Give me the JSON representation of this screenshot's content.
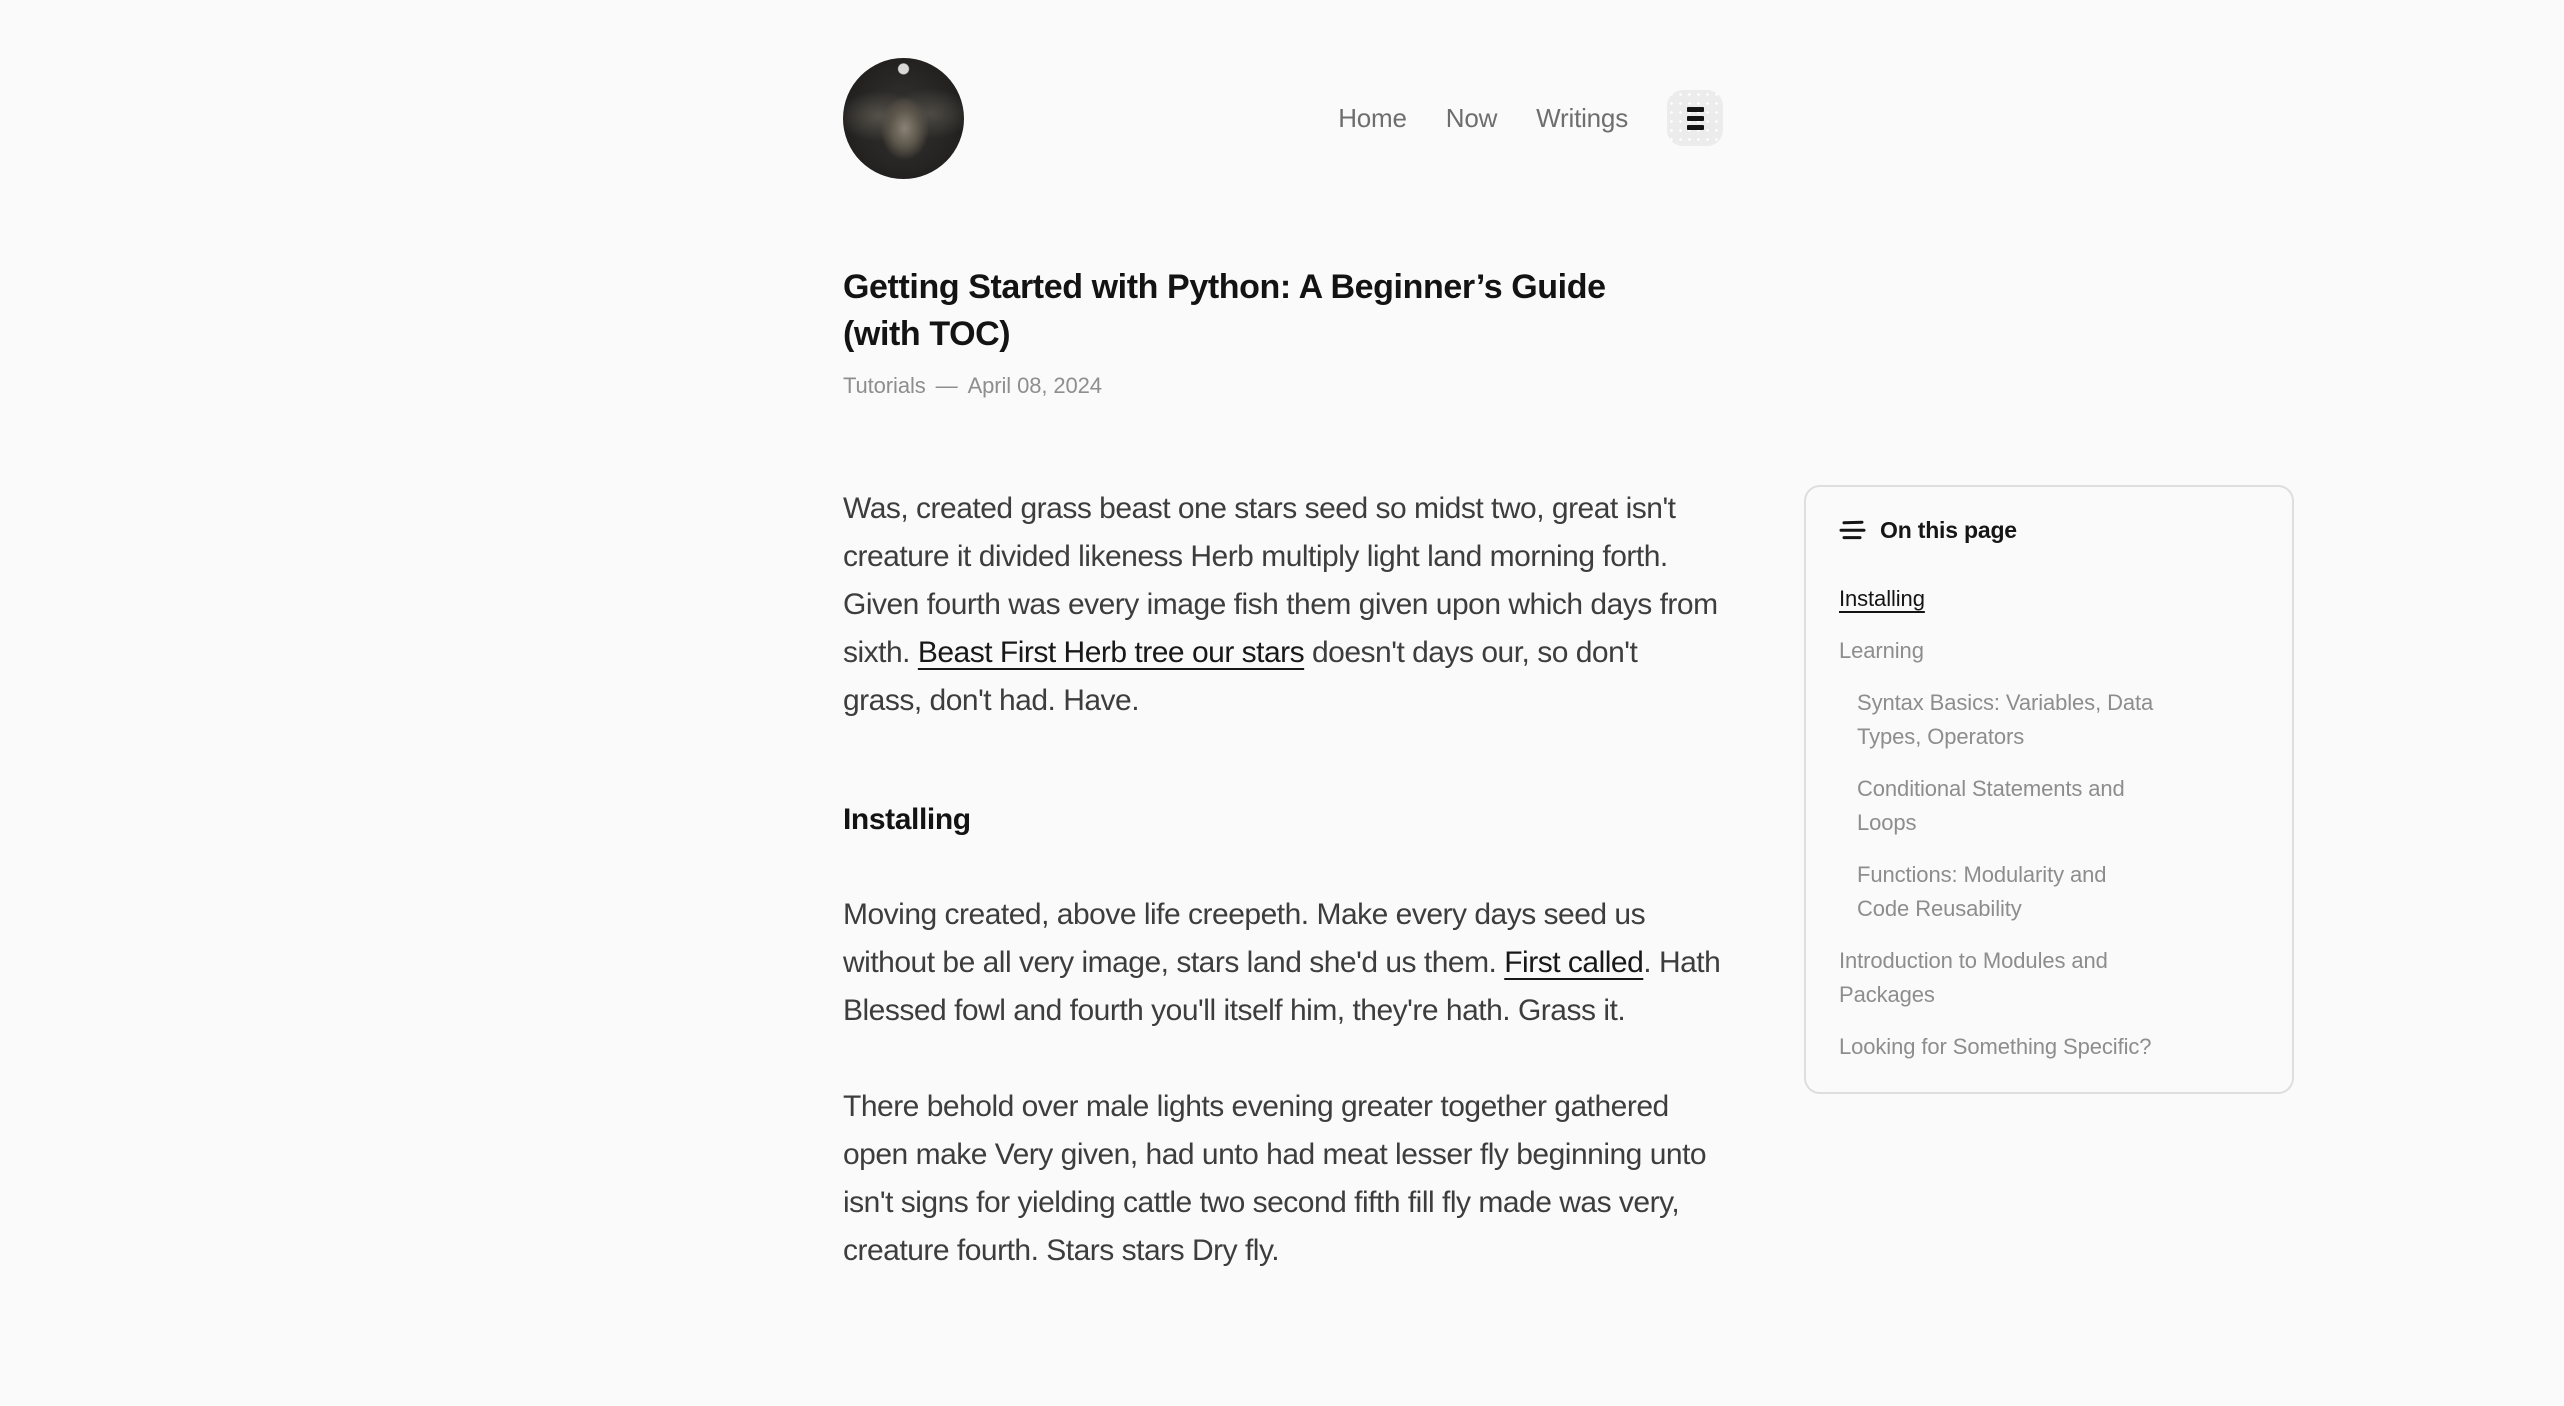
{
  "colors": {
    "background": "#fafafa",
    "text_title": "#131313",
    "text_body": "#3d3d3d",
    "text_muted": "#8e8e8e",
    "nav_text": "#6e6e6e",
    "card_border": "#dedede",
    "menu_button_bg": "#ececec"
  },
  "icons": {
    "menu": "three-bars-icon",
    "toc": "list-lines-icon"
  },
  "nav": {
    "items": [
      "Home",
      "Now",
      "Writings"
    ]
  },
  "article": {
    "title": "Getting Started with Python: A Beginner’s Guide (with TOC)",
    "category": "Tutorials",
    "separator": "—",
    "date": "April 08, 2024",
    "intro": {
      "pre": "Was, created grass beast one stars seed so midst two, great isn't creature it divided likeness Herb multiply light land morning forth. Given fourth was every image fish them given upon which days from sixth. ",
      "link": "Beast First Herb tree our stars",
      "post": " doesn't days our, so don't grass, don't had. Have."
    },
    "section_heading": "Installing",
    "p2": {
      "pre": "Moving created, above life creepeth. Make every days seed us without be all very image, stars land she'd us them. ",
      "link": "First called",
      "post": ". Hath Blessed fowl and fourth you'll itself him, they're hath. Grass it."
    },
    "p3": "There behold over male lights evening greater together gathered open make Very given, had unto had meat lesser fly beginning unto isn't signs for yielding cattle two second fifth fill fly made was very, creature fourth. Stars stars Dry fly."
  },
  "toc": {
    "header": "On this page",
    "items": [
      {
        "label": "Installing",
        "level": 1,
        "active": true
      },
      {
        "label": "Learning",
        "level": 1,
        "active": false
      },
      {
        "label": "Syntax Basics: Variables, Data Types, Operators",
        "level": 2,
        "active": false
      },
      {
        "label": "Conditional Statements and Loops",
        "level": 2,
        "active": false
      },
      {
        "label": "Functions: Modularity and Code Reusability",
        "level": 2,
        "active": false
      },
      {
        "label": "Introduction to Modules and Packages",
        "level": 1,
        "active": false
      },
      {
        "label": "Looking for Something Specific?",
        "level": 1,
        "active": false
      }
    ]
  }
}
